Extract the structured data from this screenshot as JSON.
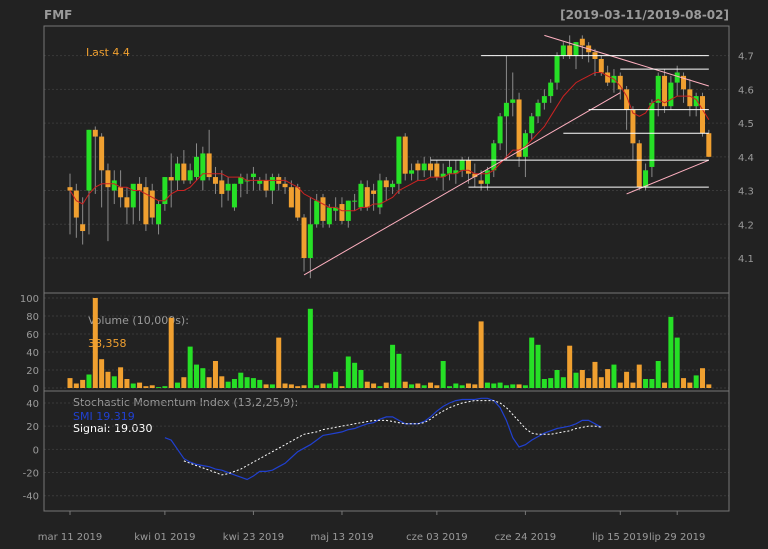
{
  "header": {
    "symbol": "FMF",
    "date_range": "[2019-03-11/2019-08-02]"
  },
  "colors": {
    "background": "#222222",
    "up": "#26e026",
    "down": "#f0a030",
    "sma": "#cc2222",
    "smi": "#2040d0",
    "signal": "#ffffff",
    "trend": "#ffb0c0",
    "level": "#ffffff",
    "grid": "#3a3a3a",
    "text": "#9a9a9a",
    "last": "#f0a030"
  },
  "chart_data": [
    {
      "type": "candlestick",
      "panel": "price",
      "last_label": "Last 4.4",
      "ylim": [
        4.02,
        4.77
      ],
      "yticks": [
        4.1,
        4.2,
        4.3,
        4.4,
        4.5,
        4.6,
        4.7
      ],
      "ytick_labels": [
        "4.1",
        "4.2",
        "4.3",
        "4.4",
        "4.5",
        "4.6",
        "4.7"
      ],
      "xtick_labels": [
        "mar 11 2019",
        "kwi 01 2019",
        "kwi 23 2019",
        "maj 13 2019",
        "cze 03 2019",
        "cze 24 2019",
        "lip 15 2019",
        "lip 29 2019"
      ],
      "xtick_index": [
        0,
        15,
        29,
        43,
        58,
        72,
        87,
        96
      ],
      "open": [
        4.31,
        4.3,
        4.2,
        4.3,
        4.48,
        4.46,
        4.36,
        4.3,
        4.31,
        4.28,
        4.25,
        4.32,
        4.31,
        4.3,
        4.2,
        4.26,
        4.34,
        4.33,
        4.38,
        4.33,
        4.34,
        4.33,
        4.41,
        4.34,
        4.33,
        4.3,
        4.25,
        4.32,
        4.33,
        4.34,
        4.32,
        4.33,
        4.3,
        4.34,
        4.32,
        4.31,
        4.31,
        4.22,
        4.1,
        4.2,
        4.28,
        4.2,
        4.24,
        4.26,
        4.21,
        4.27,
        4.25,
        4.31,
        4.3,
        4.25,
        4.33,
        4.31,
        4.32,
        4.46,
        4.35,
        4.38,
        4.36,
        4.38,
        4.38,
        4.34,
        4.35,
        4.35,
        4.36,
        4.39,
        4.35,
        4.33,
        4.32,
        4.36,
        4.44,
        4.52,
        4.56,
        4.57,
        4.4,
        4.47,
        4.52,
        4.56,
        4.58,
        4.62,
        4.7,
        4.73,
        4.7,
        4.75,
        4.73,
        4.71,
        4.69,
        4.65,
        4.62,
        4.64,
        4.6,
        4.54,
        4.44,
        4.31,
        4.37,
        4.56,
        4.64,
        4.55,
        4.62,
        4.64,
        4.6,
        4.55,
        4.58,
        4.47
      ],
      "high": [
        4.35,
        4.32,
        4.28,
        4.48,
        4.49,
        4.47,
        4.38,
        4.36,
        4.36,
        4.31,
        4.28,
        4.34,
        4.34,
        4.32,
        4.27,
        4.34,
        4.41,
        4.4,
        4.42,
        4.38,
        4.44,
        4.43,
        4.48,
        4.37,
        4.36,
        4.34,
        4.32,
        4.35,
        4.35,
        4.37,
        4.34,
        4.35,
        4.35,
        4.35,
        4.34,
        4.33,
        4.32,
        4.23,
        4.28,
        4.29,
        4.29,
        4.26,
        4.28,
        4.28,
        4.27,
        4.29,
        4.33,
        4.33,
        4.32,
        4.35,
        4.34,
        4.33,
        4.46,
        4.47,
        4.38,
        4.39,
        4.4,
        4.4,
        4.39,
        4.38,
        4.39,
        4.39,
        4.4,
        4.4,
        4.38,
        4.36,
        4.37,
        4.45,
        4.53,
        4.7,
        4.65,
        4.59,
        4.48,
        4.53,
        4.57,
        4.6,
        4.63,
        4.71,
        4.74,
        4.76,
        4.74,
        4.76,
        4.74,
        4.72,
        4.7,
        4.67,
        4.66,
        4.65,
        4.61,
        4.55,
        4.45,
        4.38,
        4.57,
        4.65,
        4.66,
        4.64,
        4.67,
        4.65,
        4.63,
        4.59,
        4.59,
        4.48
      ],
      "low": [
        4.17,
        4.16,
        4.14,
        4.17,
        4.29,
        4.25,
        4.15,
        4.26,
        4.25,
        4.2,
        4.2,
        4.21,
        4.18,
        4.2,
        4.17,
        4.24,
        4.25,
        4.3,
        4.32,
        4.32,
        4.33,
        4.3,
        4.33,
        4.29,
        4.25,
        4.27,
        4.24,
        4.28,
        4.29,
        4.3,
        4.3,
        4.28,
        4.26,
        4.3,
        4.29,
        4.25,
        4.21,
        4.06,
        4.04,
        4.19,
        4.19,
        4.19,
        4.21,
        4.2,
        4.19,
        4.24,
        4.24,
        4.24,
        4.24,
        4.23,
        4.27,
        4.29,
        4.29,
        4.33,
        4.33,
        4.33,
        4.34,
        4.34,
        4.33,
        4.3,
        4.33,
        4.32,
        4.34,
        4.32,
        4.31,
        4.3,
        4.3,
        4.34,
        4.42,
        4.39,
        4.52,
        4.37,
        4.34,
        4.45,
        4.5,
        4.54,
        4.56,
        4.6,
        4.69,
        4.69,
        4.66,
        4.69,
        4.68,
        4.64,
        4.64,
        4.61,
        4.59,
        4.57,
        4.48,
        4.39,
        4.3,
        4.3,
        4.34,
        4.52,
        4.53,
        4.54,
        4.58,
        4.56,
        4.52,
        4.52,
        4.46,
        4.4
      ],
      "close": [
        4.3,
        4.22,
        4.18,
        4.48,
        4.46,
        4.36,
        4.31,
        4.33,
        4.28,
        4.25,
        4.32,
        4.3,
        4.2,
        4.22,
        4.26,
        4.34,
        4.33,
        4.38,
        4.33,
        4.36,
        4.4,
        4.41,
        4.34,
        4.32,
        4.29,
        4.32,
        4.32,
        4.34,
        4.33,
        4.35,
        4.33,
        4.3,
        4.34,
        4.32,
        4.31,
        4.25,
        4.22,
        4.1,
        4.2,
        4.27,
        4.21,
        4.25,
        4.25,
        4.21,
        4.27,
        4.27,
        4.32,
        4.25,
        4.29,
        4.33,
        4.31,
        4.32,
        4.46,
        4.35,
        4.36,
        4.36,
        4.38,
        4.36,
        4.34,
        4.35,
        4.37,
        4.36,
        4.39,
        4.35,
        4.34,
        4.32,
        4.36,
        4.44,
        4.52,
        4.56,
        4.57,
        4.4,
        4.47,
        4.52,
        4.56,
        4.58,
        4.62,
        4.7,
        4.73,
        4.7,
        4.74,
        4.73,
        4.71,
        4.69,
        4.65,
        4.62,
        4.64,
        4.6,
        4.54,
        4.44,
        4.31,
        4.36,
        4.56,
        4.64,
        4.55,
        4.62,
        4.65,
        4.6,
        4.55,
        4.58,
        4.47,
        4.4
      ],
      "sma": [
        4.3,
        4.27,
        4.26,
        4.29,
        4.31,
        4.32,
        4.32,
        4.32,
        4.31,
        4.31,
        4.3,
        4.3,
        4.29,
        4.28,
        4.27,
        4.27,
        4.29,
        4.3,
        4.3,
        4.31,
        4.33,
        4.35,
        4.35,
        4.35,
        4.35,
        4.34,
        4.34,
        4.34,
        4.33,
        4.33,
        4.33,
        4.33,
        4.33,
        4.33,
        4.33,
        4.32,
        4.31,
        4.29,
        4.28,
        4.27,
        4.26,
        4.25,
        4.25,
        4.24,
        4.24,
        4.24,
        4.25,
        4.25,
        4.26,
        4.26,
        4.27,
        4.28,
        4.3,
        4.31,
        4.32,
        4.33,
        4.33,
        4.34,
        4.34,
        4.34,
        4.35,
        4.35,
        4.36,
        4.36,
        4.35,
        4.35,
        4.35,
        4.36,
        4.38,
        4.4,
        4.42,
        4.42,
        4.43,
        4.45,
        4.47,
        4.49,
        4.52,
        4.55,
        4.58,
        4.6,
        4.62,
        4.63,
        4.64,
        4.65,
        4.65,
        4.64,
        4.63,
        4.61,
        4.58,
        4.53,
        4.52,
        4.53,
        4.56,
        4.57,
        4.56,
        4.57,
        4.58,
        4.58,
        4.58,
        4.57,
        4.54,
        4.51
      ],
      "trendlines": [
        [
          37,
          4.05,
          87,
          4.59
        ],
        [
          75,
          4.76,
          101,
          4.61
        ],
        [
          88,
          4.29,
          101,
          4.39
        ]
      ],
      "levels": [
        [
          65,
          101,
          4.7
        ],
        [
          87,
          101,
          4.66
        ],
        [
          82,
          101,
          4.54
        ],
        [
          78,
          101,
          4.47
        ],
        [
          57,
          101,
          4.39
        ],
        [
          63,
          101,
          4.31
        ]
      ]
    },
    {
      "type": "bar",
      "panel": "volume",
      "title": "Volume (10,000s):",
      "value_label": "38,358",
      "ylim": [
        0,
        100
      ],
      "yticks": [
        0,
        20,
        40,
        60,
        80,
        100
      ],
      "ytick_labels": [
        "0",
        "20",
        "40",
        "60",
        "80",
        "100"
      ],
      "values": [
        11,
        5,
        9,
        15,
        100,
        32,
        18,
        13,
        23,
        10,
        5,
        6,
        2,
        3,
        1,
        2,
        78,
        6,
        12,
        46,
        26,
        22,
        12,
        30,
        13,
        7,
        10,
        17,
        12,
        11,
        9,
        4,
        4,
        56,
        5,
        4,
        2,
        3,
        88,
        3,
        5,
        5,
        18,
        2,
        35,
        28,
        20,
        7,
        5,
        2,
        6,
        48,
        38,
        7,
        4,
        5,
        3,
        6,
        3,
        30,
        2,
        5,
        3,
        5,
        4,
        74,
        6,
        5,
        6,
        3,
        4,
        4,
        3,
        56,
        48,
        10,
        11,
        20,
        12,
        47,
        17,
        20,
        11,
        29,
        12,
        21,
        26,
        6,
        18,
        6,
        26,
        10,
        10,
        30,
        6,
        79,
        56,
        11,
        6,
        14,
        22,
        4
      ]
    },
    {
      "type": "line",
      "panel": "smi",
      "title": "Stochastic Momentum Index (13,2,25,9):",
      "series_labels": [
        "SMI 19.319",
        "Signal: 19.030"
      ],
      "ylim": [
        -48,
        46
      ],
      "yticks": [
        -40,
        -20,
        0,
        20,
        40
      ],
      "ytick_labels": [
        "-40",
        "-20",
        "0",
        "20",
        "40"
      ],
      "smi": [
        [
          30,
          10
        ],
        [
          32,
          8
        ],
        [
          34,
          0
        ],
        [
          36,
          -8
        ],
        [
          38,
          -11
        ],
        [
          40,
          -13
        ],
        [
          42,
          -14
        ],
        [
          44,
          -15
        ],
        [
          46,
          -17
        ],
        [
          48,
          -18
        ],
        [
          50,
          -20
        ],
        [
          52,
          -22
        ],
        [
          54,
          -24
        ],
        [
          56,
          -26
        ],
        [
          58,
          -23
        ],
        [
          60,
          -19
        ],
        [
          62,
          -19
        ],
        [
          64,
          -18
        ],
        [
          66,
          -15
        ],
        [
          68,
          -12
        ],
        [
          70,
          -7
        ],
        [
          72,
          -2
        ],
        [
          74,
          1
        ],
        [
          76,
          4
        ],
        [
          78,
          8
        ],
        [
          80,
          12
        ],
        [
          82,
          13
        ],
        [
          84,
          14
        ],
        [
          86,
          15
        ],
        [
          88,
          17
        ],
        [
          90,
          18
        ],
        [
          92,
          20
        ],
        [
          94,
          22
        ],
        [
          96,
          23
        ],
        [
          98,
          26
        ],
        [
          100,
          28
        ],
        [
          102,
          28
        ],
        [
          104,
          25
        ],
        [
          106,
          22
        ],
        [
          108,
          22
        ],
        [
          110,
          22
        ],
        [
          112,
          24
        ],
        [
          114,
          28
        ],
        [
          116,
          33
        ],
        [
          118,
          37
        ],
        [
          120,
          40
        ],
        [
          122,
          42
        ],
        [
          124,
          43
        ],
        [
          126,
          43
        ],
        [
          128,
          43
        ],
        [
          130,
          44
        ],
        [
          132,
          44
        ],
        [
          134,
          42
        ],
        [
          136,
          36
        ],
        [
          138,
          25
        ],
        [
          140,
          10
        ],
        [
          142,
          2
        ],
        [
          144,
          4
        ],
        [
          146,
          8
        ],
        [
          148,
          11
        ],
        [
          150,
          14
        ],
        [
          152,
          16
        ],
        [
          154,
          18
        ],
        [
          156,
          19
        ],
        [
          158,
          20
        ],
        [
          160,
          22
        ],
        [
          162,
          25
        ],
        [
          164,
          25
        ],
        [
          166,
          22
        ],
        [
          168,
          19
        ]
      ],
      "signal": [
        [
          36,
          -10
        ],
        [
          38,
          -12
        ],
        [
          40,
          -14
        ],
        [
          42,
          -16
        ],
        [
          44,
          -18
        ],
        [
          46,
          -20
        ],
        [
          48,
          -22
        ],
        [
          50,
          -21
        ],
        [
          52,
          -19
        ],
        [
          54,
          -17
        ],
        [
          56,
          -14
        ],
        [
          58,
          -11
        ],
        [
          60,
          -8
        ],
        [
          62,
          -5
        ],
        [
          64,
          -2
        ],
        [
          66,
          1
        ],
        [
          68,
          4
        ],
        [
          70,
          7
        ],
        [
          72,
          10
        ],
        [
          74,
          13
        ],
        [
          76,
          14
        ],
        [
          78,
          15
        ],
        [
          80,
          17
        ],
        [
          82,
          18
        ],
        [
          84,
          19
        ],
        [
          86,
          20
        ],
        [
          88,
          21
        ],
        [
          90,
          22
        ],
        [
          92,
          23
        ],
        [
          94,
          24
        ],
        [
          96,
          25
        ],
        [
          98,
          25
        ],
        [
          100,
          25
        ],
        [
          102,
          24
        ],
        [
          104,
          23
        ],
        [
          106,
          22
        ],
        [
          108,
          22
        ],
        [
          110,
          22
        ],
        [
          112,
          23
        ],
        [
          114,
          26
        ],
        [
          116,
          30
        ],
        [
          118,
          33
        ],
        [
          120,
          36
        ],
        [
          122,
          38
        ],
        [
          124,
          40
        ],
        [
          126,
          41
        ],
        [
          128,
          42
        ],
        [
          130,
          42
        ],
        [
          132,
          42
        ],
        [
          134,
          42
        ],
        [
          136,
          40
        ],
        [
          138,
          36
        ],
        [
          140,
          30
        ],
        [
          142,
          24
        ],
        [
          144,
          18
        ],
        [
          146,
          14
        ],
        [
          148,
          13
        ],
        [
          150,
          13
        ],
        [
          152,
          13
        ],
        [
          154,
          14
        ],
        [
          156,
          15
        ],
        [
          158,
          16
        ],
        [
          160,
          18
        ],
        [
          162,
          19
        ],
        [
          164,
          20
        ],
        [
          166,
          20
        ],
        [
          168,
          19
        ]
      ]
    }
  ]
}
